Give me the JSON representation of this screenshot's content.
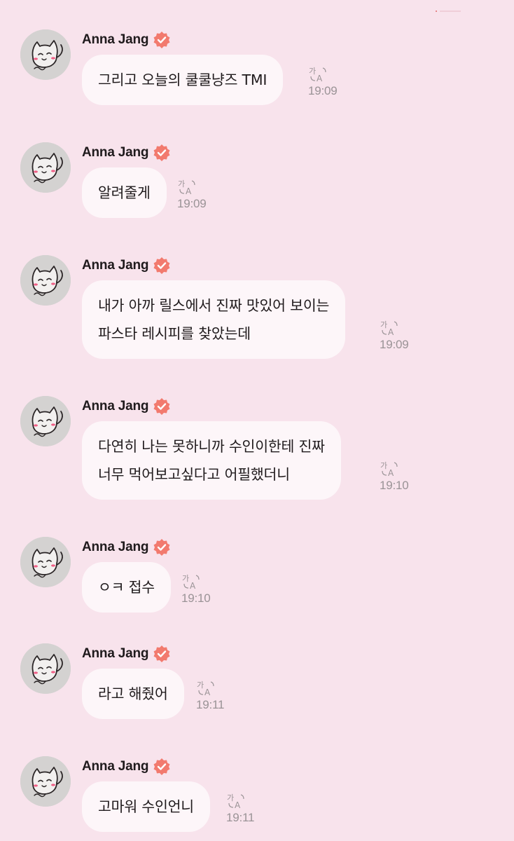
{
  "sender": {
    "name": "Anna Jang",
    "verified_icon": "verified-badge-icon",
    "avatar_icon": "cat-doodle-avatar",
    "accent_color": "#f27a6e"
  },
  "translate_icon": "translate-icon",
  "messages": [
    {
      "lines": [
        "그리고 오늘의 쿨쿨냥즈 TMI"
      ],
      "time": "19:09"
    },
    {
      "lines": [
        "알려줄게"
      ],
      "time": "19:09"
    },
    {
      "lines": [
        "내가 아까 릴스에서 진짜 맛있어 보이는",
        "파스타 레시피를 찾았는데"
      ],
      "time": "19:09"
    },
    {
      "lines": [
        "다연히 나는 못하니까 수인이한테 진짜",
        "너무 먹어보고싶다고 어필했더니"
      ],
      "time": "19:10"
    },
    {
      "lines": [
        "ㅇㅋ 접수"
      ],
      "time": "19:10"
    },
    {
      "lines": [
        "라고 해줬어"
      ],
      "time": "19:11"
    },
    {
      "lines": [
        "고마워 수인언니"
      ],
      "time": "19:11"
    }
  ]
}
